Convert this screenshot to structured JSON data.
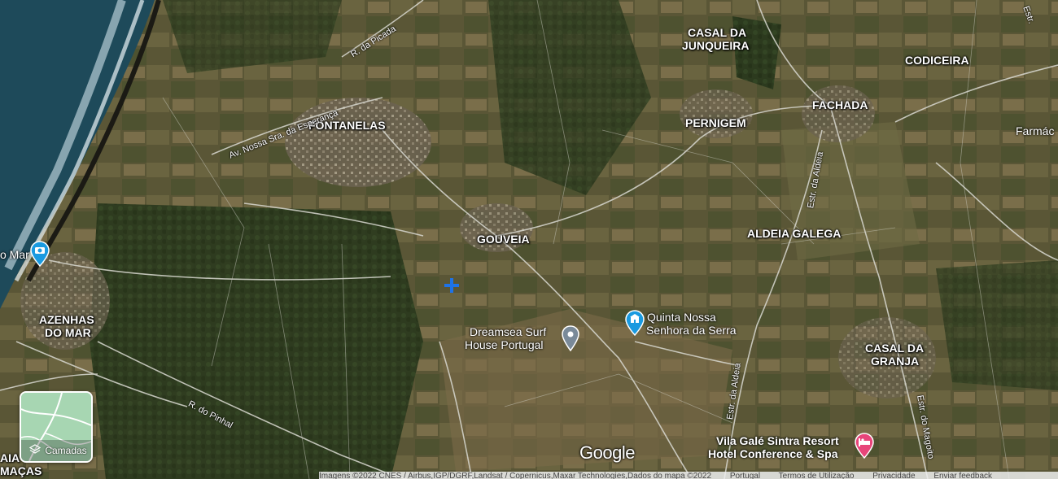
{
  "places": [
    {
      "id": "fontanelas",
      "label": "FONTANELAS"
    },
    {
      "id": "gouveia",
      "label": "GOUVEIA"
    },
    {
      "id": "casal-junqueira-1",
      "label": "CASAL DA"
    },
    {
      "id": "casal-junqueira-2",
      "label": "JUNQUEIRA"
    },
    {
      "id": "codiceira",
      "label": "CODICEIRA"
    },
    {
      "id": "fachada",
      "label": "FACHADA"
    },
    {
      "id": "pernigem",
      "label": "PERNIGEM"
    },
    {
      "id": "aldeia-galega",
      "label": "ALDEIA GALEGA"
    },
    {
      "id": "azenhas-1",
      "label": "AZENHAS"
    },
    {
      "id": "azenhas-2",
      "label": "DO MAR"
    },
    {
      "id": "casal-granja-1",
      "label": "CASAL DA"
    },
    {
      "id": "casal-granja-2",
      "label": "GRANJA"
    },
    {
      "id": "praia-1",
      "label": "AIA"
    },
    {
      "id": "praia-2",
      "label": "MAÇAS"
    },
    {
      "id": "farmacia",
      "label": "Farmác"
    }
  ],
  "roads": {
    "picada": "R. da Picada",
    "esperanca": "Av. Nossa Sra. da Esperança",
    "aldeia_north": "Estr. da Aldeia",
    "aldeia_south": "Estr. da Aldeia",
    "pinhal": "R. do Pinhal",
    "magoito": "Estr. do Magoito",
    "top_right": "Estr."
  },
  "pois": {
    "dreamsea_1": "Dreamsea Surf",
    "dreamsea_2": "House Portugal",
    "quinta_1": "Quinta Nossa",
    "quinta_2": "Senhora da Serra",
    "vila_gale_1": "Vila Galé Sintra Resort",
    "vila_gale_2": "Hotel Conference & Spa",
    "azenhas_poi": "o Mar"
  },
  "layers_label": "Camadas",
  "google_logo": "Google",
  "footer": {
    "imagery": "Imagens ©2022 CNES / Airbus,IGP/DGRF,Landsat / Copernicus,Maxar Technologies,Dados do mapa ©2022",
    "region": "Portugal",
    "terms": "Termos de Utilização",
    "privacy": "Privacidade",
    "feedback": "Enviar feedback"
  },
  "colors": {
    "sea": "#1e4a5a",
    "poi_blue": "#1a9ae0",
    "poi_gray": "#7a8a99",
    "hotel_pink": "#e8457a",
    "marker_blue": "#1e73e8"
  }
}
